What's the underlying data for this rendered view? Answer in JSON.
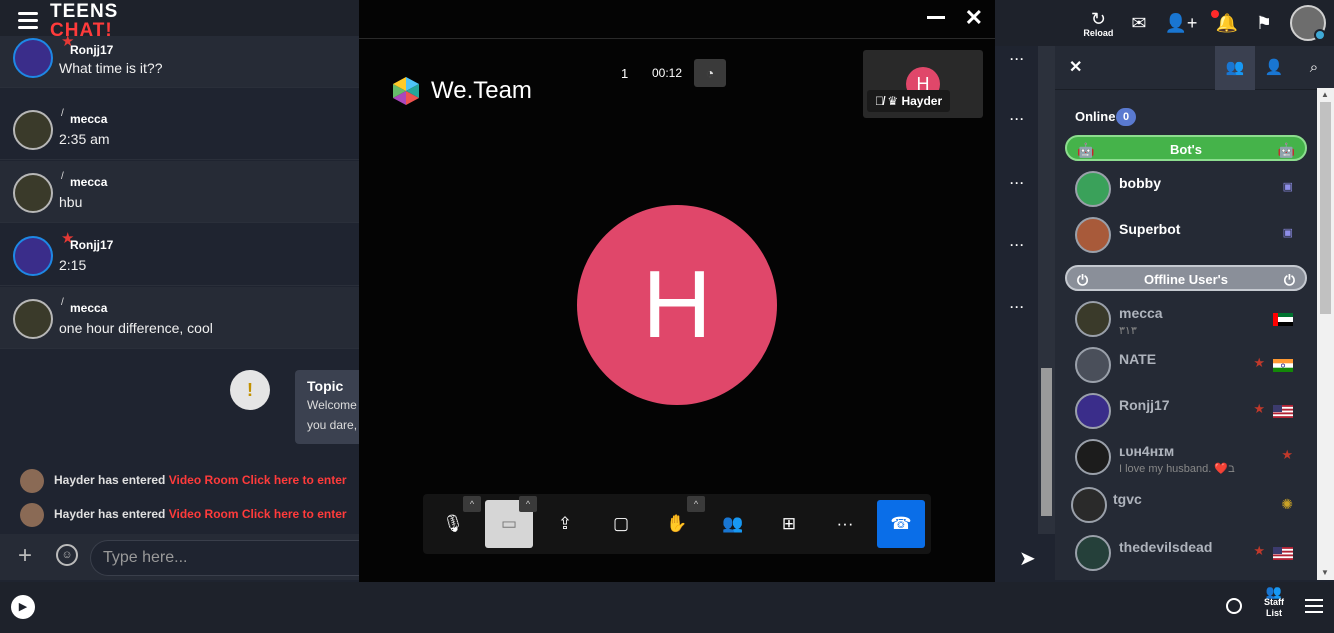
{
  "app": {
    "logo_line1": "TEENS",
    "logo_line2": "CHAT!"
  },
  "topbar": {
    "reload_label": "Reload"
  },
  "messages": [
    {
      "name": "Ronjj17",
      "text": "What time is it??",
      "rank": "star"
    },
    {
      "name": "mecca",
      "text": "2:35 am",
      "rank": "slash"
    },
    {
      "name": "mecca",
      "text": "hbu",
      "rank": "slash"
    },
    {
      "name": "Ronjj17",
      "text": "2:15",
      "rank": "star"
    },
    {
      "name": "mecca",
      "text": "one hour difference, cool",
      "rank": "slash"
    }
  ],
  "topic": {
    "title": "Topic",
    "line1": "Welcome",
    "line2": "you dare,"
  },
  "system": [
    {
      "user": "Hayder",
      "action": "has entered",
      "link": "Video Room Click here to enter"
    },
    {
      "user": "Hayder",
      "action": "has entered",
      "link": "Video Room Click here to enter"
    }
  ],
  "input": {
    "placeholder": "Type here..."
  },
  "video": {
    "brand": "We.Team",
    "participants": "1",
    "timer": "00:12",
    "thumb_initial": "H",
    "thumb_name": "Hayder",
    "main_initial": "H"
  },
  "panel": {
    "online_label": "Online",
    "online_count": "0",
    "bots_label": "Bot's",
    "offline_label": "Offline User's",
    "bots": [
      {
        "name": "bobby"
      },
      {
        "name": "Superbot"
      }
    ],
    "offline": [
      {
        "name": "mecca",
        "sub": "٣١٣"
      },
      {
        "name": "NATE",
        "sub": ""
      },
      {
        "name": "Ronjj17",
        "sub": ""
      },
      {
        "name": "ʟᴜʜ4ʜɪᴍ",
        "sub": "I love my husband. ❤️ב"
      },
      {
        "name": "tgvc",
        "sub": ""
      },
      {
        "name": "thedevilsdead",
        "sub": ""
      }
    ]
  },
  "footer": {
    "staff_line1": "Staff",
    "staff_line2": "List"
  },
  "colors": {
    "accent_red": "#ff3b3b",
    "avatar_pink": "#e0476a",
    "end_call_blue": "#0a6ee8",
    "bots_green": "#45b34a"
  }
}
